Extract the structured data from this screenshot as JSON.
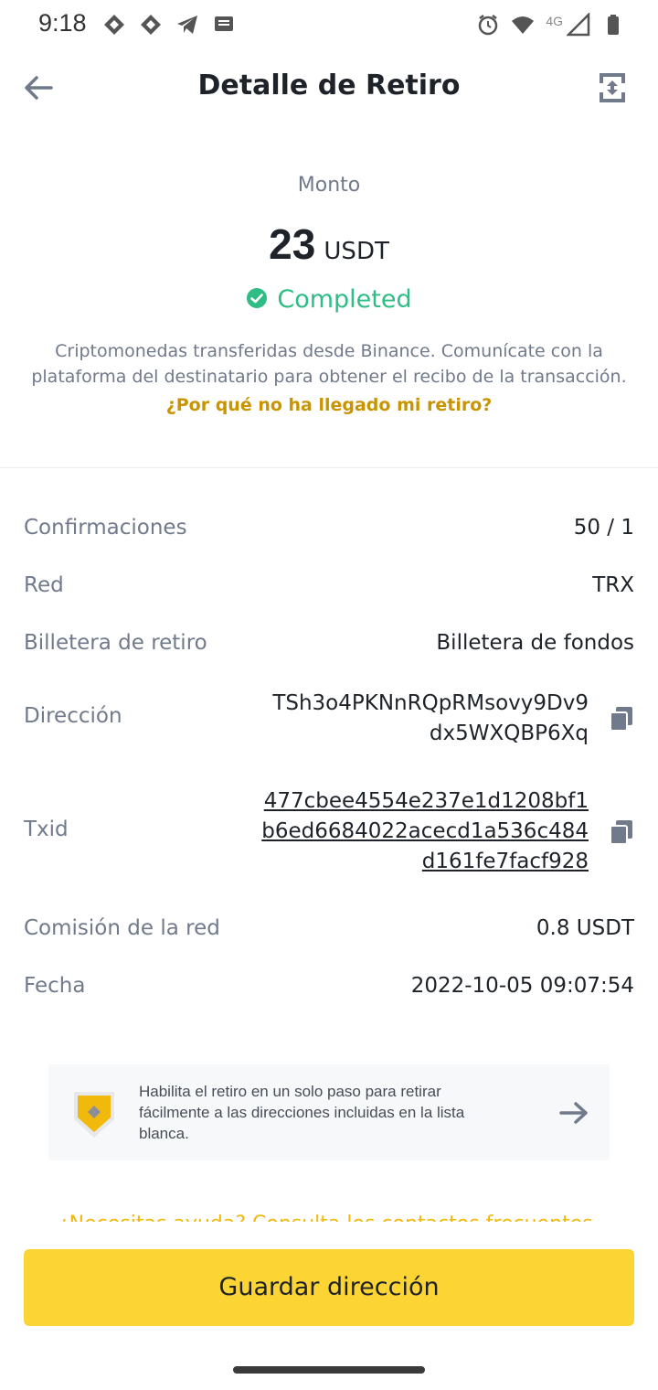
{
  "status_bar": {
    "time": "9:18",
    "network": "4G"
  },
  "header": {
    "title": "Detalle de Retiro"
  },
  "amount": {
    "label": "Monto",
    "value": "23",
    "unit": "USDT"
  },
  "status": {
    "text": "Completed",
    "color": "#2ebd85"
  },
  "description": "Criptomonedas transferidas desde Binance. Comunícate con la plataforma del destinatario para obtener el recibo de la transacción.",
  "why_link": "¿Por qué no ha llegado mi retiro?",
  "details": {
    "confirmations": {
      "label": "Confirmaciones",
      "value": "50 / 1"
    },
    "network": {
      "label": "Red",
      "value": "TRX"
    },
    "wallet": {
      "label": "Billetera de retiro",
      "value": "Billetera de fondos"
    },
    "address": {
      "label": "Dirección",
      "lines": [
        "TSh3o4PKNnRQpRMsovy9Dv9",
        "dx5WXQBP6Xq"
      ]
    },
    "txid": {
      "label": "Txid",
      "lines": [
        "477cbee4554e237e1d1208bf1",
        "b6ed6684022acecd1a536c484",
        "d161fe7facf928"
      ]
    },
    "fee": {
      "label": "Comisión de la red",
      "value": "0.8 USDT"
    },
    "date": {
      "label": "Fecha",
      "value": "2022-10-05 09:07:54"
    }
  },
  "banner": {
    "text": "Habilita el retiro en un solo paso para retirar fácilmente a las direcciones incluidas en la lista blanca."
  },
  "cut_off_text": "¿Necesitas ayuda? Consulta los contactos frecuentes",
  "actions": {
    "save_address": "Guardar dirección"
  },
  "colors": {
    "accent": "#fcd535",
    "link": "#c99400",
    "success": "#2ebd85"
  }
}
